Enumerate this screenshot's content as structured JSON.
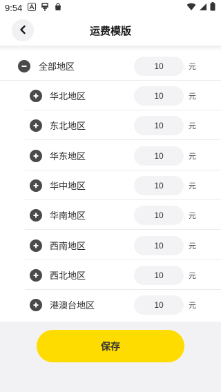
{
  "status_bar": {
    "time": "9:54",
    "icons": [
      "font-a-icon",
      "system-notification-icon",
      "shopping-bag-icon",
      "wifi-icon",
      "signal-icon",
      "battery-icon"
    ]
  },
  "header": {
    "title": "运费模版",
    "back_icon": "chevron-left-icon"
  },
  "regions": [
    {
      "name": "全部地区",
      "value": "10",
      "unit": "元",
      "icon": "minus-circle-icon"
    },
    {
      "name": "华北地区",
      "value": "10",
      "unit": "元",
      "icon": "plus-circle-icon"
    },
    {
      "name": "东北地区",
      "value": "10",
      "unit": "元",
      "icon": "plus-circle-icon"
    },
    {
      "name": "华东地区",
      "value": "10",
      "unit": "元",
      "icon": "plus-circle-icon"
    },
    {
      "name": "华中地区",
      "value": "10",
      "unit": "元",
      "icon": "plus-circle-icon"
    },
    {
      "name": "华南地区",
      "value": "10",
      "unit": "元",
      "icon": "plus-circle-icon"
    },
    {
      "name": "西南地区",
      "value": "10",
      "unit": "元",
      "icon": "plus-circle-icon"
    },
    {
      "name": "西北地区",
      "value": "10",
      "unit": "元",
      "icon": "plus-circle-icon"
    },
    {
      "name": "港澳台地区",
      "value": "10",
      "unit": "元",
      "icon": "plus-circle-icon"
    }
  ],
  "footer": {
    "save_label": "保存"
  },
  "colors": {
    "accent": "#ffdc00",
    "icon": "#4a4a4a",
    "page_background": "#f2f2f4"
  }
}
